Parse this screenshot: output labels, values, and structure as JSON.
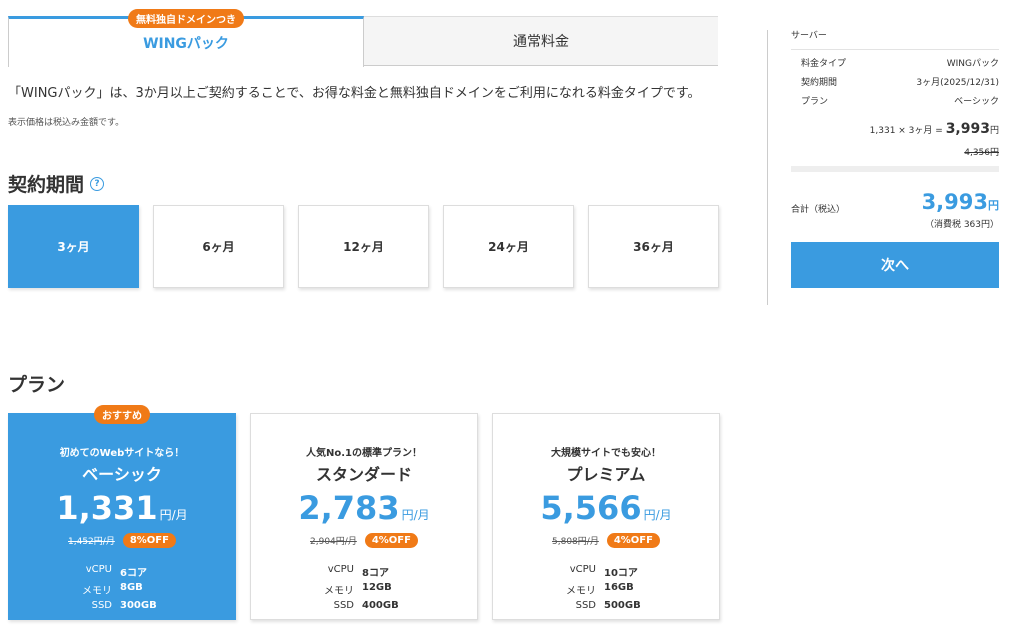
{
  "tabs": [
    {
      "label": "WINGパック",
      "badge": "無料独自ドメインつき",
      "active": true
    },
    {
      "label": "通常料金",
      "active": false
    }
  ],
  "description": "「WINGパック」は、3か月以上ご契約することで、お得な料金と無料独自ドメインをご利用になれる料金タイプです。",
  "tax_note": "表示価格は税込み金額です。",
  "period_section": {
    "title": "契約期間",
    "help_icon": "?"
  },
  "periods": [
    {
      "label": "3ヶ月",
      "selected": true
    },
    {
      "label": "6ヶ月",
      "selected": false
    },
    {
      "label": "12ヶ月",
      "selected": false
    },
    {
      "label": "24ヶ月",
      "selected": false
    },
    {
      "label": "36ヶ月",
      "selected": false
    }
  ],
  "plan_section": {
    "title": "プラン"
  },
  "plans": [
    {
      "badge": "おすすめ",
      "tagline": "初めてのWebサイトなら！",
      "name": "ベーシック",
      "price": "1,331",
      "unit": "円/月",
      "old_price": "1,452円/月",
      "off": "8%OFF",
      "specs": {
        "vcpu_label": "vCPU",
        "vcpu": "6コア",
        "mem_label": "メモリ",
        "mem": "8GB",
        "ssd_label": "SSD",
        "ssd": "300GB"
      },
      "selected": true
    },
    {
      "tagline": "人気No.1の標準プラン！",
      "name": "スタンダード",
      "price": "2,783",
      "unit": "円/月",
      "old_price": "2,904円/月",
      "off": "4%OFF",
      "specs": {
        "vcpu_label": "vCPU",
        "vcpu": "8コア",
        "mem_label": "メモリ",
        "mem": "12GB",
        "ssd_label": "SSD",
        "ssd": "400GB"
      },
      "selected": false
    },
    {
      "tagline": "大規模サイトでも安心！",
      "name": "プレミアム",
      "price": "5,566",
      "unit": "円/月",
      "old_price": "5,808円/月",
      "off": "4%OFF",
      "specs": {
        "vcpu_label": "vCPU",
        "vcpu": "10コア",
        "mem_label": "メモリ",
        "mem": "16GB",
        "ssd_label": "SSD",
        "ssd": "500GB"
      },
      "selected": false
    }
  ],
  "summary": {
    "title": "サーバー",
    "rows": [
      {
        "label": "料金タイプ",
        "value": "WINGパック"
      },
      {
        "label": "契約期間",
        "value": "3ヶ月(2025/12/31)"
      },
      {
        "label": "プラン",
        "value": "ベーシック"
      }
    ],
    "calc_prefix": "1,331 × 3ヶ月 = ",
    "calc_total": "3,993",
    "calc_yen": "円",
    "old_total": "4,356円",
    "total_label": "合計（税込）",
    "total_price": "3,993",
    "total_yen": "円",
    "tax_line": "（消費税 363円）",
    "next_label": "次へ"
  },
  "colors": {
    "accent": "#3a9be0",
    "badge": "#f07a17"
  }
}
